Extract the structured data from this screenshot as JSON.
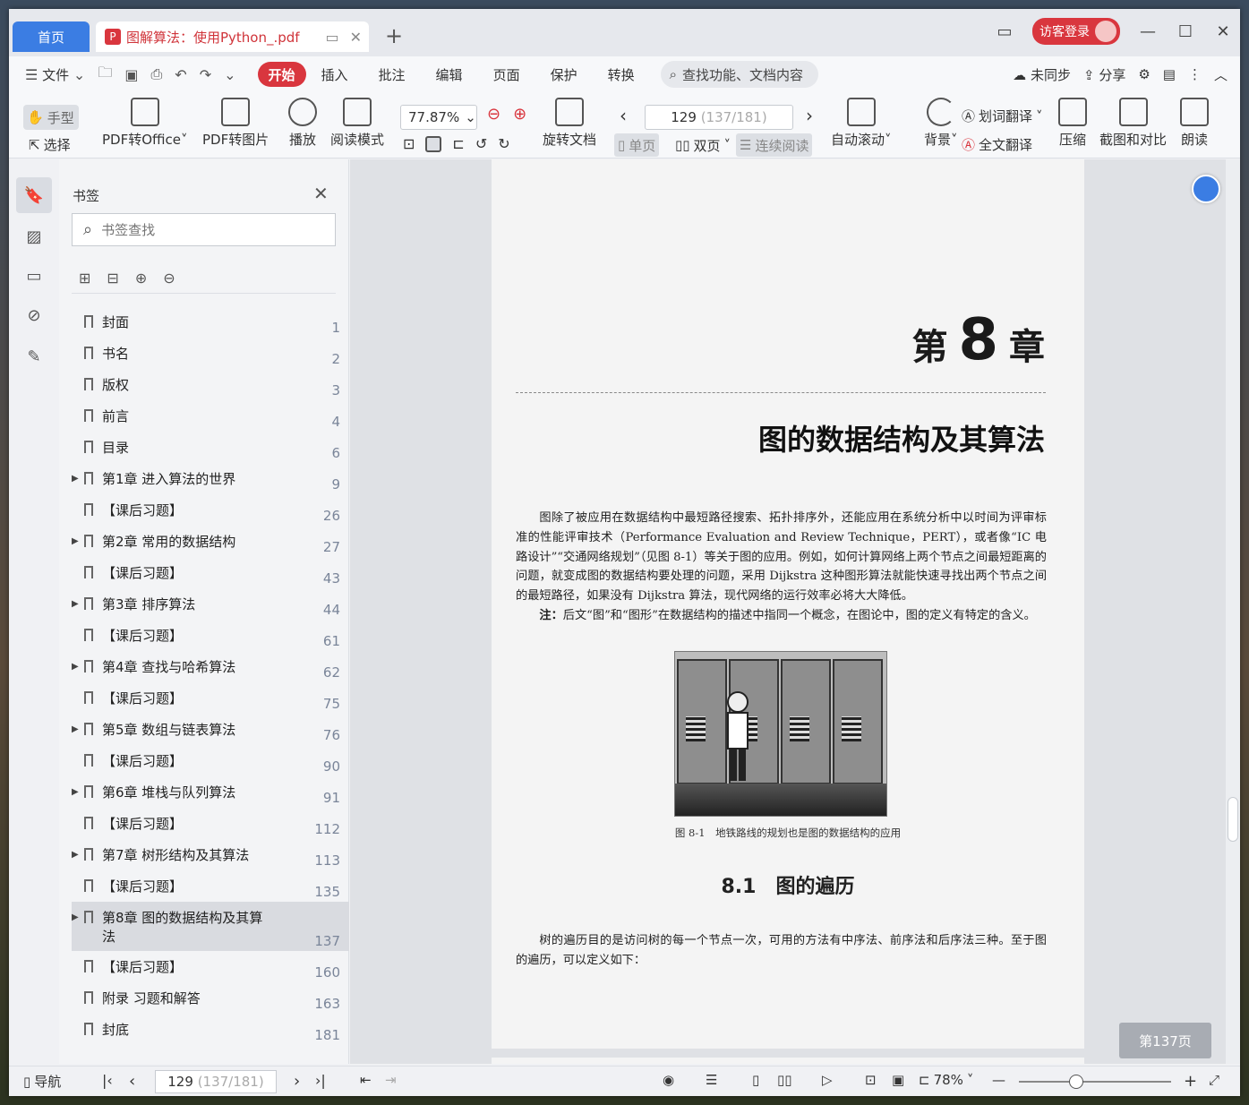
{
  "tabs": {
    "home": "首页",
    "doc_title": "图解算法：使用Python_.pdf",
    "login": "访客登录"
  },
  "menu": {
    "file": "文件",
    "tabs": [
      "开始",
      "插入",
      "批注",
      "编辑",
      "页面",
      "保护",
      "转换"
    ],
    "search_placeholder": "查找功能、文档内容",
    "sync": "未同步",
    "share": "分享"
  },
  "toolbar": {
    "hand": "手型",
    "select": "选择",
    "pdf_to_office": "PDF转Office",
    "pdf_to_image": "PDF转图片",
    "play": "播放",
    "read_mode": "阅读模式",
    "zoom": "77.87%",
    "rotate_doc": "旋转文档",
    "page_value": "129",
    "page_sub": "(137/181)",
    "single": "单页",
    "double": "双页",
    "continuous": "连续阅读",
    "auto_scroll": "自动滚动",
    "background": "背景",
    "word_translate": "划词翻译",
    "full_translate": "全文翻译",
    "compress": "压缩",
    "screenshot_compare": "截图和对比",
    "read_aloud": "朗读"
  },
  "bookmarks": {
    "title": "书签",
    "search_placeholder": "书签查找",
    "items": [
      {
        "label": "封面",
        "page": "1",
        "expand": false
      },
      {
        "label": "书名",
        "page": "2",
        "expand": false
      },
      {
        "label": "版权",
        "page": "3",
        "expand": false
      },
      {
        "label": "前言",
        "page": "4",
        "expand": false
      },
      {
        "label": "目录",
        "page": "6",
        "expand": false
      },
      {
        "label": "第1章 进入算法的世界",
        "page": "9",
        "expand": true
      },
      {
        "label": "【课后习题】",
        "page": "26",
        "expand": false
      },
      {
        "label": "第2章 常用的数据结构",
        "page": "27",
        "expand": true
      },
      {
        "label": "【课后习题】",
        "page": "43",
        "expand": false
      },
      {
        "label": "第3章 排序算法",
        "page": "44",
        "expand": true
      },
      {
        "label": "【课后习题】",
        "page": "61",
        "expand": false
      },
      {
        "label": "第4章 查找与哈希算法",
        "page": "62",
        "expand": true
      },
      {
        "label": "【课后习题】",
        "page": "75",
        "expand": false
      },
      {
        "label": "第5章 数组与链表算法",
        "page": "76",
        "expand": true
      },
      {
        "label": "【课后习题】",
        "page": "90",
        "expand": false
      },
      {
        "label": "第6章 堆栈与队列算法",
        "page": "91",
        "expand": true
      },
      {
        "label": "【课后习题】",
        "page": "112",
        "expand": false
      },
      {
        "label": "第7章 树形结构及其算法",
        "page": "113",
        "expand": true
      },
      {
        "label": "【课后习题】",
        "page": "135",
        "expand": false
      },
      {
        "label": "第8章 图的数据结构及其算法",
        "page": "137",
        "expand": true,
        "selected": true
      },
      {
        "label": "【课后习题】",
        "page": "160",
        "expand": false
      },
      {
        "label": "附录 习题和解答",
        "page": "163",
        "expand": false
      },
      {
        "label": "封底",
        "page": "181",
        "expand": false
      }
    ]
  },
  "document": {
    "chapter_prefix": "第",
    "chapter_num": "8",
    "chapter_suffix": "章",
    "chapter_title": "图的数据结构及其算法",
    "para1": "图除了被应用在数据结构中最短路径搜索、拓扑排序外，还能应用在系统分析中以时间为评审标准的性能评审技术（Performance Evaluation and Review Technique，PERT），或者像“IC 电路设计”“交通网络规划”（见图 8-1）等关于图的应用。例如，如何计算网络上两个节点之间最短距离的问题，就变成图的数据结构要处理的问题，采用 Dijkstra 这种图形算法就能快速寻找出两个节点之间的最短路径，如果没有 Dijkstra 算法，现代网络的运行效率必将大大降低。",
    "note_label": "注：",
    "note": "后文“图”和“图形”在数据结构的描述中指同一个概念，在图论中，图的定义有特定的含义。",
    "figure_caption": "图 8-1　地铁路线的规划也是图的数据结构的应用",
    "section_title": "8.1　图的遍历",
    "para2": "树的遍历目的是访问树的每一个节点一次，可用的方法有中序法、前序法和后序法三种。至于图的遍历，可以定义如下：",
    "page_badge": "第137页"
  },
  "statusbar": {
    "nav": "导航",
    "page_value": "129",
    "page_sub": "(137/181)",
    "zoom": "78%"
  }
}
